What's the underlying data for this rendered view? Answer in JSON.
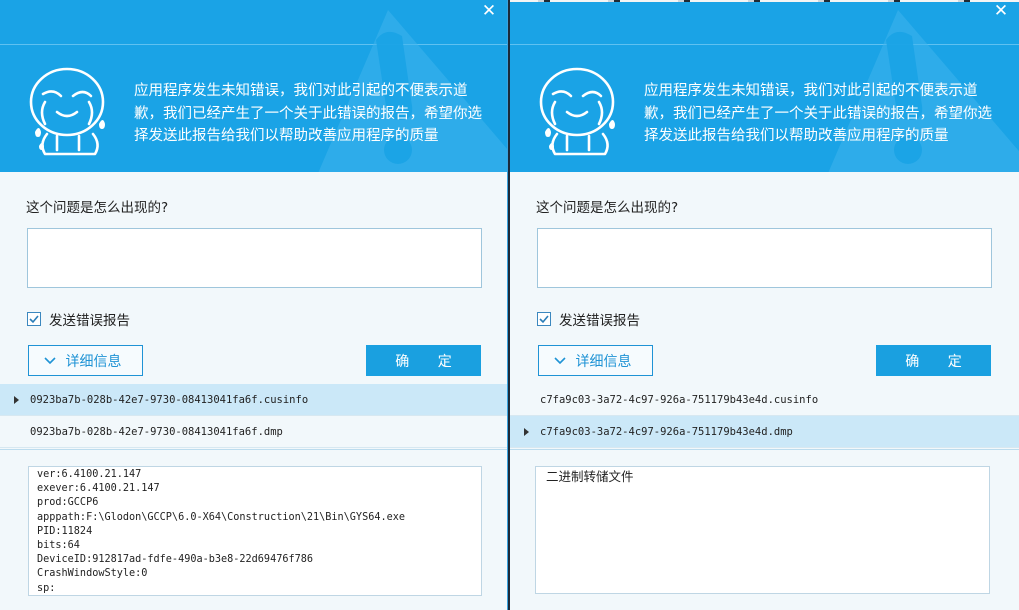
{
  "windows": [
    {
      "message": "应用程序发生未知错误，我们对此引起的不便表示道歉，我们已经产生了一个关于此错误的报告，希望你选择发送此报告给我们以帮助改善应用程序的质量",
      "question_label": "这个问题是怎么出现的?",
      "question_value": "",
      "send_report_label": "发送错误报告",
      "send_report_checked": true,
      "details_button": "详细信息",
      "ok_button": "确 定",
      "files": [
        {
          "name": "0923ba7b-028b-42e7-9730-08413041fa6f.cusinfo",
          "selected": true
        },
        {
          "name": "0923ba7b-028b-42e7-9730-08413041fa6f.dmp",
          "selected": false
        }
      ],
      "detail_lines": [
        "ver:6.4100.21.147",
        "exever:6.4100.21.147",
        "prod:GCCP6",
        "apppath:F:\\Glodon\\GCCP\\6.0-X64\\Construction\\21\\Bin\\GYS64.exe",
        "PID:11824",
        "bits:64",
        "DeviceID:912817ad-fdfe-490a-b3e8-22d69476f786",
        "CrashWindowStyle:0",
        "sp:"
      ]
    },
    {
      "message": "应用程序发生未知错误，我们对此引起的不便表示道歉，我们已经产生了一个关于此错误的报告，希望你选择发送此报告给我们以帮助改善应用程序的质量",
      "question_label": "这个问题是怎么出现的?",
      "question_value": "",
      "send_report_label": "发送错误报告",
      "send_report_checked": true,
      "details_button": "详细信息",
      "ok_button": "确 定",
      "files": [
        {
          "name": "c7fa9c03-3a72-4c97-926a-751179b43e4d.cusinfo",
          "selected": false
        },
        {
          "name": "c7fa9c03-3a72-4c97-926a-751179b43e4d.dmp",
          "selected": true
        }
      ],
      "detail_text": "二进制转储文件"
    }
  ],
  "icons": {
    "close": "close-icon",
    "mascot": "crying-mascot-icon",
    "checkbox": "checkmark-icon",
    "chevron": "chevron-down-icon",
    "row_marker": "triangle-right-icon"
  },
  "colors": {
    "header": "#1aa3e6",
    "button": "#1aa0e0",
    "selected_row": "#cbe8f8",
    "body": "#f2f8fb"
  }
}
